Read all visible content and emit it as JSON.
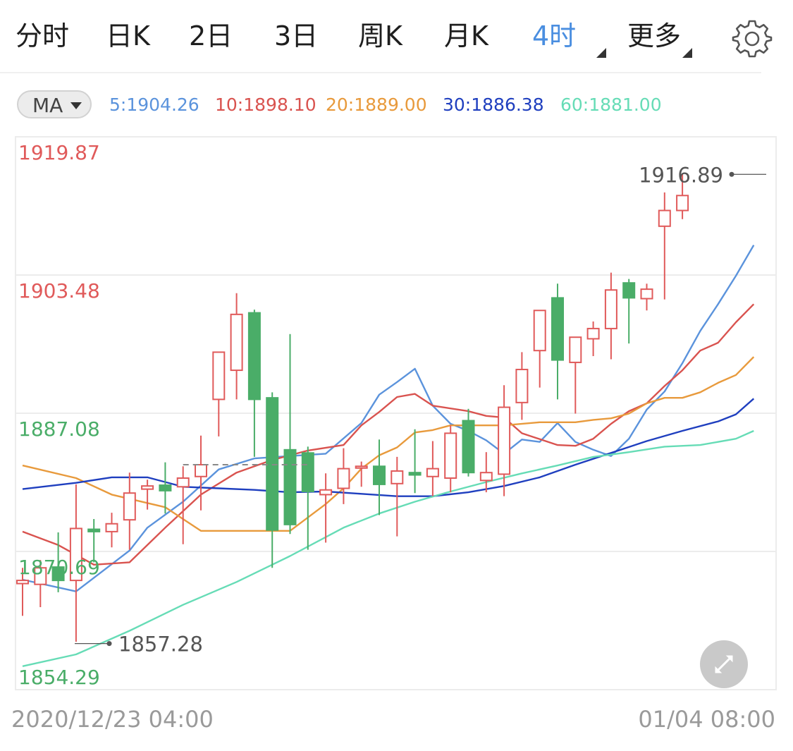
{
  "tabs": [
    {
      "label": "分时",
      "active": false
    },
    {
      "label": "日K",
      "active": false
    },
    {
      "label": "2日",
      "active": false
    },
    {
      "label": "3日",
      "active": false
    },
    {
      "label": "周K",
      "active": false
    },
    {
      "label": "月K",
      "active": false
    },
    {
      "label": "4时",
      "active": true
    },
    {
      "label": "更多",
      "active": false
    }
  ],
  "icons": {
    "settings": "gear-icon",
    "expand": "expand-arrows-icon",
    "dropdown": "triangle-down-icon"
  },
  "indicator": {
    "selected": "MA",
    "values": [
      {
        "label": "5:1904.26",
        "color": "#5b93dc"
      },
      {
        "label": "10:1898.10",
        "color": "#d9534f"
      },
      {
        "label": "20:1889.00",
        "color": "#e89a3c"
      },
      {
        "label": "30:1886.38",
        "color": "#1f3fbf"
      },
      {
        "label": "60:1881.00",
        "color": "#66dcb6"
      }
    ]
  },
  "colors": {
    "up": "#e05a5a",
    "down": "#4aad68",
    "grid": "#ececec"
  },
  "chart_data": {
    "type": "candlestick",
    "y_axis_labels": [
      {
        "value": 1919.87,
        "label": "1919.87",
        "color": "#e05a5a"
      },
      {
        "value": 1903.48,
        "label": "1903.48",
        "color": "#e05a5a"
      },
      {
        "value": 1887.08,
        "label": "1887.08",
        "color": "#4aad68"
      },
      {
        "value": 1870.69,
        "label": "1870.69",
        "color": "#4aad68"
      },
      {
        "value": 1854.29,
        "label": "1854.29",
        "color": "#4aad68"
      }
    ],
    "ylim": [
      1854.29,
      1919.87
    ],
    "x_labels": {
      "start": "2020/12/23 04:00",
      "end": "01/04 08:00"
    },
    "max_marker": {
      "value": 1916.89,
      "label": "1916.89"
    },
    "min_marker": {
      "value": 1857.28,
      "label": "1857.28"
    },
    "candles": [
      {
        "o": 1864.9,
        "h": 1866.9,
        "l": 1860.8,
        "c": 1865.3
      },
      {
        "o": 1864.8,
        "h": 1867.9,
        "l": 1861.9,
        "c": 1866.9
      },
      {
        "o": 1867.0,
        "h": 1871.4,
        "l": 1863.8,
        "c": 1865.3
      },
      {
        "o": 1865.3,
        "h": 1877.5,
        "l": 1857.5,
        "c": 1871.9
      },
      {
        "o": 1871.8,
        "h": 1873.1,
        "l": 1867.6,
        "c": 1871.5
      },
      {
        "o": 1871.5,
        "h": 1873.9,
        "l": 1869.5,
        "c": 1872.5
      },
      {
        "o": 1873.0,
        "h": 1879.0,
        "l": 1869.2,
        "c": 1876.4
      },
      {
        "o": 1876.9,
        "h": 1878.1,
        "l": 1874.3,
        "c": 1877.3
      },
      {
        "o": 1877.4,
        "h": 1880.3,
        "l": 1873.8,
        "c": 1876.7
      },
      {
        "o": 1877.2,
        "h": 1879.8,
        "l": 1869.9,
        "c": 1878.3
      },
      {
        "o": 1878.5,
        "h": 1883.7,
        "l": 1874.2,
        "c": 1880.0
      },
      {
        "o": 1888.3,
        "h": 1890.4,
        "l": 1883.6,
        "c": 1894.3
      },
      {
        "o": 1892.0,
        "h": 1901.8,
        "l": 1888.3,
        "c": 1899.1
      },
      {
        "o": 1899.3,
        "h": 1899.7,
        "l": 1881.0,
        "c": 1888.3
      },
      {
        "o": 1888.5,
        "h": 1889.2,
        "l": 1866.9,
        "c": 1871.7
      },
      {
        "o": 1881.9,
        "h": 1896.6,
        "l": 1871.2,
        "c": 1872.4
      },
      {
        "o": 1881.5,
        "h": 1882.3,
        "l": 1869.2,
        "c": 1876.6
      },
      {
        "o": 1876.2,
        "h": 1878.9,
        "l": 1870.1,
        "c": 1876.8
      },
      {
        "o": 1877.0,
        "h": 1882.1,
        "l": 1875.0,
        "c": 1879.5
      },
      {
        "o": 1879.6,
        "h": 1880.4,
        "l": 1877.2,
        "c": 1879.8
      },
      {
        "o": 1879.8,
        "h": 1883.2,
        "l": 1873.6,
        "c": 1877.5
      },
      {
        "o": 1877.6,
        "h": 1881.0,
        "l": 1870.9,
        "c": 1879.2
      },
      {
        "o": 1879.0,
        "h": 1884.5,
        "l": 1876.4,
        "c": 1878.7
      },
      {
        "o": 1878.5,
        "h": 1883.0,
        "l": 1876.0,
        "c": 1879.5
      },
      {
        "o": 1878.3,
        "h": 1885.0,
        "l": 1876.5,
        "c": 1884.0
      },
      {
        "o": 1885.6,
        "h": 1887.1,
        "l": 1878.5,
        "c": 1879.0
      },
      {
        "o": 1878.0,
        "h": 1881.6,
        "l": 1876.5,
        "c": 1879.0
      },
      {
        "o": 1878.8,
        "h": 1890.1,
        "l": 1876.0,
        "c": 1887.3
      },
      {
        "o": 1887.9,
        "h": 1894.3,
        "l": 1885.7,
        "c": 1892.1
      },
      {
        "o": 1894.5,
        "h": 1897.0,
        "l": 1889.8,
        "c": 1899.6
      },
      {
        "o": 1901.2,
        "h": 1903.0,
        "l": 1888.3,
        "c": 1893.3
      },
      {
        "o": 1893.0,
        "h": 1895.1,
        "l": 1886.5,
        "c": 1896.2
      },
      {
        "o": 1896.0,
        "h": 1898.2,
        "l": 1893.8,
        "c": 1897.3
      },
      {
        "o": 1897.3,
        "h": 1904.4,
        "l": 1893.4,
        "c": 1902.2
      },
      {
        "o": 1903.1,
        "h": 1903.6,
        "l": 1895.4,
        "c": 1901.2
      },
      {
        "o": 1901.1,
        "h": 1903.0,
        "l": 1899.6,
        "c": 1902.3
      },
      {
        "o": 1910.3,
        "h": 1914.6,
        "l": 1901.0,
        "c": 1912.3
      },
      {
        "o": 1912.3,
        "h": 1916.9,
        "l": 1911.2,
        "c": 1914.2
      }
    ],
    "ma_series": [
      {
        "name": "MA5",
        "color": "#5b93dc",
        "points": [
          [
            0,
            1865.4
          ],
          [
            3,
            1863.9
          ],
          [
            6,
            1869.1
          ],
          [
            7,
            1872.0
          ],
          [
            9,
            1875.3
          ],
          [
            11,
            1879.4
          ],
          [
            13,
            1880.8
          ],
          [
            15,
            1881.1
          ],
          [
            17,
            1881.4
          ],
          [
            19,
            1885.3
          ],
          [
            20,
            1888.9
          ],
          [
            21,
            1890.5
          ],
          [
            22,
            1892.2
          ],
          [
            23,
            1887.5
          ],
          [
            24,
            1885.2
          ],
          [
            25,
            1884.3
          ],
          [
            26,
            1883.1
          ],
          [
            27,
            1881.4
          ],
          [
            28,
            1883.2
          ],
          [
            29,
            1882.9
          ],
          [
            30,
            1885.3
          ],
          [
            31,
            1882.9
          ],
          [
            32,
            1881.9
          ],
          [
            33,
            1881.1
          ],
          [
            34,
            1883.3
          ],
          [
            35,
            1887.0
          ],
          [
            36,
            1889.3
          ],
          [
            37,
            1892.9
          ],
          [
            38,
            1897.0
          ],
          [
            39,
            1900.4
          ],
          [
            40,
            1904.0
          ],
          [
            41,
            1907.9
          ]
        ]
      },
      {
        "name": "MA10",
        "color": "#d9534f",
        "points": [
          [
            0,
            1871.5
          ],
          [
            2,
            1869.8
          ],
          [
            4,
            1867.3
          ],
          [
            6,
            1867.6
          ],
          [
            8,
            1872.0
          ],
          [
            10,
            1876.2
          ],
          [
            12,
            1879.0
          ],
          [
            14,
            1880.6
          ],
          [
            16,
            1881.8
          ],
          [
            18,
            1882.5
          ],
          [
            19,
            1885.0
          ],
          [
            20,
            1886.7
          ],
          [
            21,
            1888.6
          ],
          [
            22,
            1889.0
          ],
          [
            23,
            1887.5
          ],
          [
            25,
            1886.8
          ],
          [
            26,
            1886.2
          ],
          [
            27,
            1886.0
          ],
          [
            28,
            1884.0
          ],
          [
            30,
            1882.5
          ],
          [
            31,
            1882.4
          ],
          [
            32,
            1883.3
          ],
          [
            33,
            1885.2
          ],
          [
            34,
            1886.8
          ],
          [
            35,
            1887.8
          ],
          [
            36,
            1890.0
          ],
          [
            37,
            1892.0
          ],
          [
            38,
            1894.5
          ],
          [
            39,
            1895.5
          ],
          [
            40,
            1898.1
          ],
          [
            41,
            1900.4
          ]
        ]
      },
      {
        "name": "MA20",
        "color": "#e89a3c",
        "points": [
          [
            0,
            1879.9
          ],
          [
            3,
            1878.3
          ],
          [
            5,
            1876.2
          ],
          [
            8,
            1874.6
          ],
          [
            10,
            1871.6
          ],
          [
            13,
            1871.6
          ],
          [
            15,
            1871.6
          ],
          [
            17,
            1875.0
          ],
          [
            18,
            1877.0
          ],
          [
            19,
            1879.5
          ],
          [
            20,
            1881.2
          ],
          [
            21,
            1882.2
          ],
          [
            22,
            1884.1
          ],
          [
            23,
            1884.4
          ],
          [
            24,
            1885.0
          ],
          [
            25,
            1885.0
          ],
          [
            27,
            1885.0
          ],
          [
            29,
            1885.4
          ],
          [
            31,
            1885.4
          ],
          [
            32,
            1885.7
          ],
          [
            33,
            1885.9
          ],
          [
            34,
            1886.5
          ],
          [
            35,
            1887.8
          ],
          [
            36,
            1888.5
          ],
          [
            37,
            1888.5
          ],
          [
            38,
            1889.2
          ],
          [
            39,
            1890.4
          ],
          [
            40,
            1891.4
          ],
          [
            41,
            1893.7
          ]
        ]
      },
      {
        "name": "MA30",
        "color": "#1f3fbf",
        "points": [
          [
            0,
            1876.9
          ],
          [
            3,
            1877.7
          ],
          [
            5,
            1878.4
          ],
          [
            7,
            1878.4
          ],
          [
            9,
            1877.2
          ],
          [
            11,
            1877.0
          ],
          [
            13,
            1876.8
          ],
          [
            15,
            1876.5
          ],
          [
            17,
            1876.6
          ],
          [
            19,
            1876.3
          ],
          [
            21,
            1876.0
          ],
          [
            23,
            1876.0
          ],
          [
            25,
            1876.5
          ],
          [
            27,
            1877.3
          ],
          [
            29,
            1878.4
          ],
          [
            31,
            1880.0
          ],
          [
            33,
            1881.5
          ],
          [
            35,
            1883.0
          ],
          [
            37,
            1884.3
          ],
          [
            39,
            1885.5
          ],
          [
            40,
            1886.4
          ],
          [
            41,
            1888.4
          ]
        ]
      },
      {
        "name": "MA60",
        "color": "#66dcb6",
        "points": [
          [
            0,
            1854.4
          ],
          [
            3,
            1855.9
          ],
          [
            6,
            1858.9
          ],
          [
            9,
            1862.2
          ],
          [
            12,
            1865.1
          ],
          [
            15,
            1868.4
          ],
          [
            18,
            1872.0
          ],
          [
            20,
            1873.8
          ],
          [
            22,
            1875.3
          ],
          [
            24,
            1876.6
          ],
          [
            26,
            1877.8
          ],
          [
            28,
            1878.9
          ],
          [
            30,
            1879.9
          ],
          [
            32,
            1881.0
          ],
          [
            34,
            1881.6
          ],
          [
            36,
            1882.3
          ],
          [
            38,
            1882.5
          ],
          [
            40,
            1883.3
          ],
          [
            41,
            1884.3
          ]
        ]
      }
    ]
  }
}
